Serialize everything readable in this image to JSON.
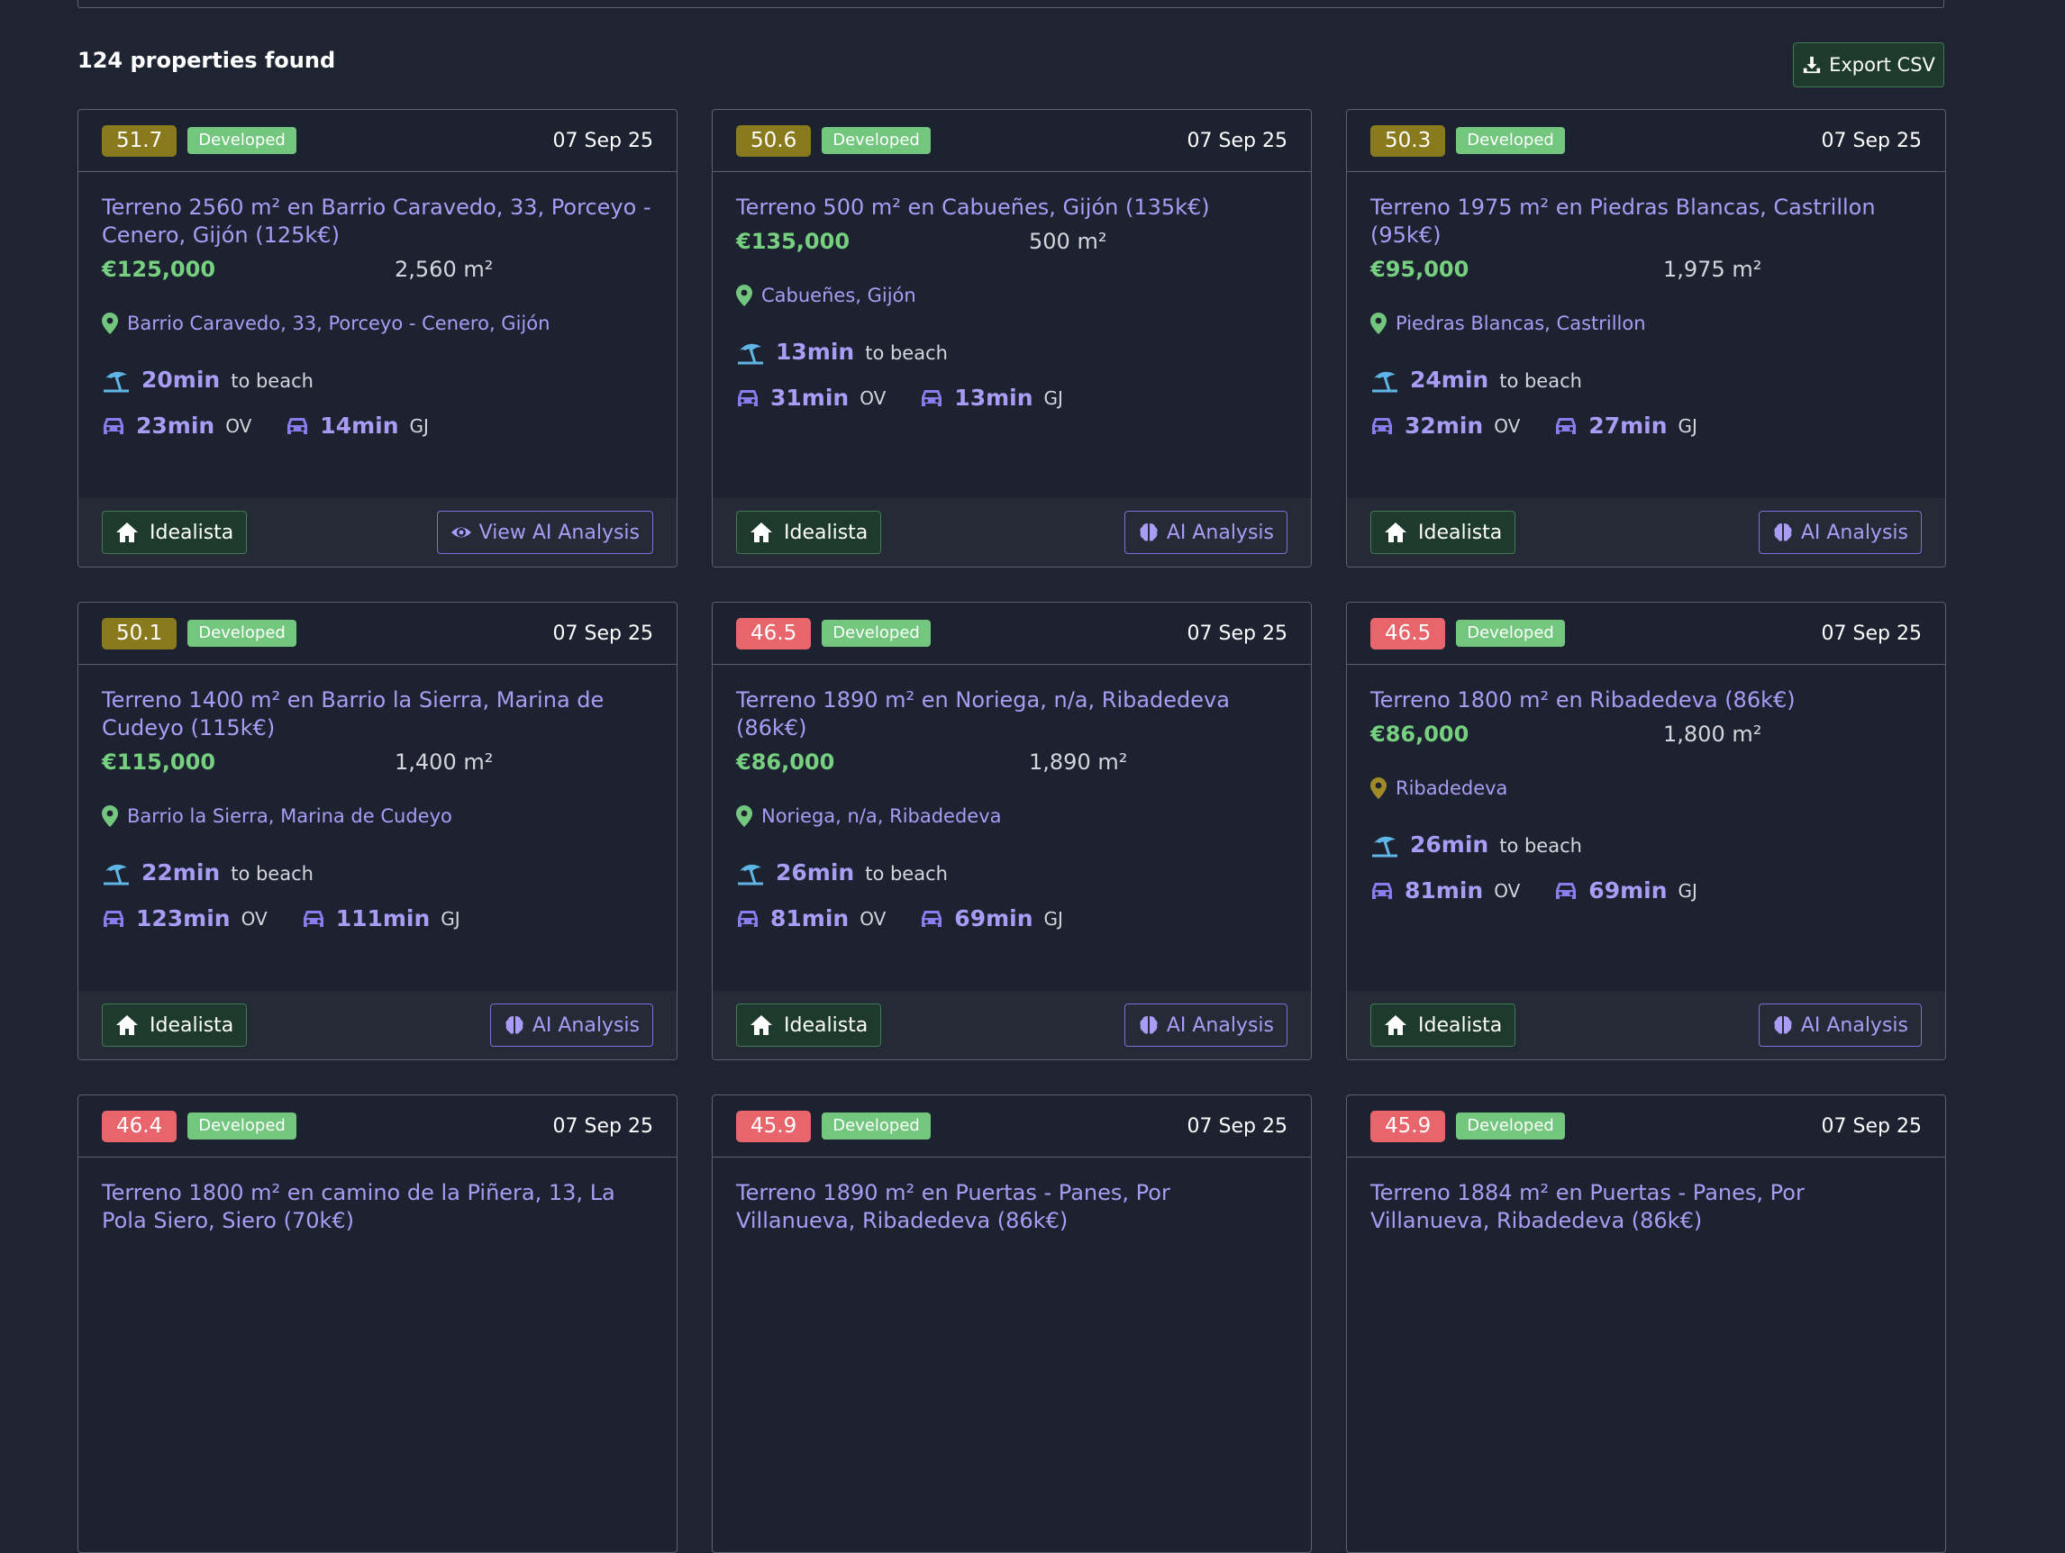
{
  "summary": {
    "count_text": "124 properties found"
  },
  "export": {
    "label": "Export CSV"
  },
  "cards": [
    {
      "score": "51.7",
      "score_color": "olive",
      "status": "Developed",
      "date": "07 Sep 25",
      "title": "Terreno 2560 m² en Barrio Caravedo, 33, Porceyo - Cenero, Gijón (125k€)",
      "price": "€125,000",
      "area": "2,560 m²",
      "location": "Barrio Caravedo, 33, Porceyo - Cenero, Gijón",
      "pin_color": "#73c67d",
      "beach_time": "20min",
      "beach_label": "to beach",
      "drive1_time": "23min",
      "drive1_label": "OV",
      "drive2_time": "14min",
      "drive2_label": "GJ",
      "idealista_label": "Idealista",
      "ai_label": "View AI Analysis",
      "ai_icon": "eye-icon"
    },
    {
      "score": "50.6",
      "score_color": "olive",
      "status": "Developed",
      "date": "07 Sep 25",
      "title": "Terreno 500 m² en Cabueñes, Gijón (135k€)",
      "price": "€135,000",
      "area": "500 m²",
      "location": "Cabueñes, Gijón",
      "pin_color": "#73c67d",
      "beach_time": "13min",
      "beach_label": "to beach",
      "drive1_time": "31min",
      "drive1_label": "OV",
      "drive2_time": "13min",
      "drive2_label": "GJ",
      "idealista_label": "Idealista",
      "ai_label": "AI Analysis",
      "ai_icon": "brain-icon"
    },
    {
      "score": "50.3",
      "score_color": "olive",
      "status": "Developed",
      "date": "07 Sep 25",
      "title": "Terreno 1975 m² en Piedras Blancas, Castrillon (95k€)",
      "price": "€95,000",
      "area": "1,975 m²",
      "location": "Piedras Blancas, Castrillon",
      "pin_color": "#73c67d",
      "beach_time": "24min",
      "beach_label": "to beach",
      "drive1_time": "32min",
      "drive1_label": "OV",
      "drive2_time": "27min",
      "drive2_label": "GJ",
      "idealista_label": "Idealista",
      "ai_label": "AI Analysis",
      "ai_icon": "brain-icon"
    },
    {
      "score": "50.1",
      "score_color": "olive",
      "status": "Developed",
      "date": "07 Sep 25",
      "title": "Terreno 1400 m² en Barrio la Sierra, Marina de Cudeyo (115k€)",
      "price": "€115,000",
      "area": "1,400 m²",
      "location": "Barrio la Sierra, Marina de Cudeyo",
      "pin_color": "#73c67d",
      "beach_time": "22min",
      "beach_label": "to beach",
      "drive1_time": "123min",
      "drive1_label": "OV",
      "drive2_time": "111min",
      "drive2_label": "GJ",
      "idealista_label": "Idealista",
      "ai_label": "AI Analysis",
      "ai_icon": "brain-icon"
    },
    {
      "score": "46.5",
      "score_color": "red",
      "status": "Developed",
      "date": "07 Sep 25",
      "title": "Terreno 1890 m² en Noriega, n/a, Ribadedeva (86k€)",
      "price": "€86,000",
      "area": "1,890 m²",
      "location": "Noriega, n/a, Ribadedeva",
      "pin_color": "#73c67d",
      "beach_time": "26min",
      "beach_label": "to beach",
      "drive1_time": "81min",
      "drive1_label": "OV",
      "drive2_time": "69min",
      "drive2_label": "GJ",
      "idealista_label": "Idealista",
      "ai_label": "AI Analysis",
      "ai_icon": "brain-icon"
    },
    {
      "score": "46.5",
      "score_color": "red",
      "status": "Developed",
      "date": "07 Sep 25",
      "title": "Terreno 1800 m² en Ribadedeva (86k€)",
      "price": "€86,000",
      "area": "1,800 m²",
      "location": "Ribadedeva",
      "pin_color": "#a08a28",
      "beach_time": "26min",
      "beach_label": "to beach",
      "drive1_time": "81min",
      "drive1_label": "OV",
      "drive2_time": "69min",
      "drive2_label": "GJ",
      "idealista_label": "Idealista",
      "ai_label": "AI Analysis",
      "ai_icon": "brain-icon"
    },
    {
      "score": "46.4",
      "score_color": "red",
      "status": "Developed",
      "date": "07 Sep 25",
      "title": "Terreno 1800 m² en camino de la Piñera, 13, La Pola Siero, Siero (70k€)"
    },
    {
      "score": "45.9",
      "score_color": "red",
      "status": "Developed",
      "date": "07 Sep 25",
      "title": "Terreno 1890 m² en Puertas - Panes, Por Villanueva, Ribadedeva (86k€)"
    },
    {
      "score": "45.9",
      "score_color": "red",
      "status": "Developed",
      "date": "07 Sep 25",
      "title": "Terreno 1884 m² en Puertas - Panes, Por Villanueva, Ribadedeva (86k€)"
    }
  ]
}
